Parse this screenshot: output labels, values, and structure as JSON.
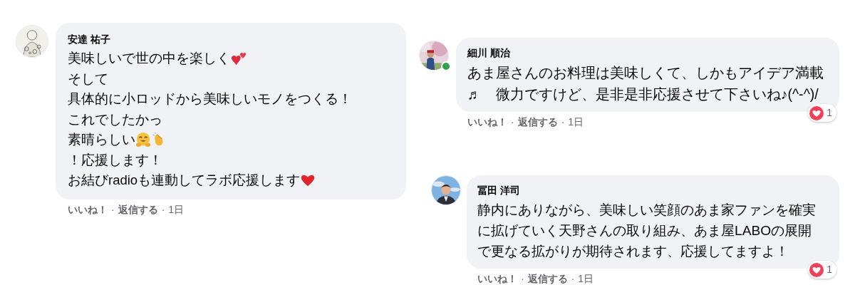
{
  "comments": [
    {
      "author": "安達 祐子",
      "online": false,
      "lines": [
        [
          {
            "kind": "text",
            "text": "美味しいで世の中を楽しく"
          },
          {
            "kind": "two-hearts"
          }
        ],
        [
          {
            "kind": "text",
            "text": "そして"
          }
        ],
        [
          {
            "kind": "text",
            "text": "具体的に小ロッドから美味しいモノをつくる！"
          }
        ],
        [
          {
            "kind": "text",
            "text": "これでしたかっ"
          }
        ],
        [
          {
            "kind": "text",
            "text": "素晴らしい"
          },
          {
            "kind": "hug"
          },
          {
            "kind": "clap"
          }
        ],
        [
          {
            "kind": "text",
            "text": "！応援します！"
          }
        ],
        [
          {
            "kind": "text",
            "text": "お結びradioも連動してラボ応援します"
          },
          {
            "kind": "heart"
          }
        ]
      ],
      "like": "いいね！",
      "separator_1": "·",
      "reply": "返信する",
      "separator_2": "·",
      "time": "1日"
    },
    {
      "author": "細川 順治",
      "online": true,
      "lines": [
        [
          {
            "kind": "text",
            "text": "あま屋さんのお料理は美味しくて、しかもアイデア満載"
          }
        ],
        [
          {
            "kind": "text",
            "text": "♬　微力ですけど、是非是非応援させて下さいね♪(^-^)/"
          }
        ]
      ],
      "reaction_count": "1",
      "like": "いいね！",
      "separator_1": "·",
      "reply": "返信する",
      "separator_2": "·",
      "time": "1日"
    },
    {
      "author": "冨田 洋司",
      "online": false,
      "lines": [
        [
          {
            "kind": "text",
            "text": "静内にありながら、美味しい笑顔のあま家ファンを確実"
          }
        ],
        [
          {
            "kind": "text",
            "text": "に拡げていく天野さんの取り組み、あま屋LABOの展開"
          }
        ],
        [
          {
            "kind": "text",
            "text": "で更なる拡がりが期待されます、応援してますよ！"
          }
        ]
      ],
      "reaction_count": "1",
      "like": "いいね！",
      "separator_1": "·",
      "reply": "返信する",
      "separator_2": "·",
      "time": "1日"
    }
  ]
}
